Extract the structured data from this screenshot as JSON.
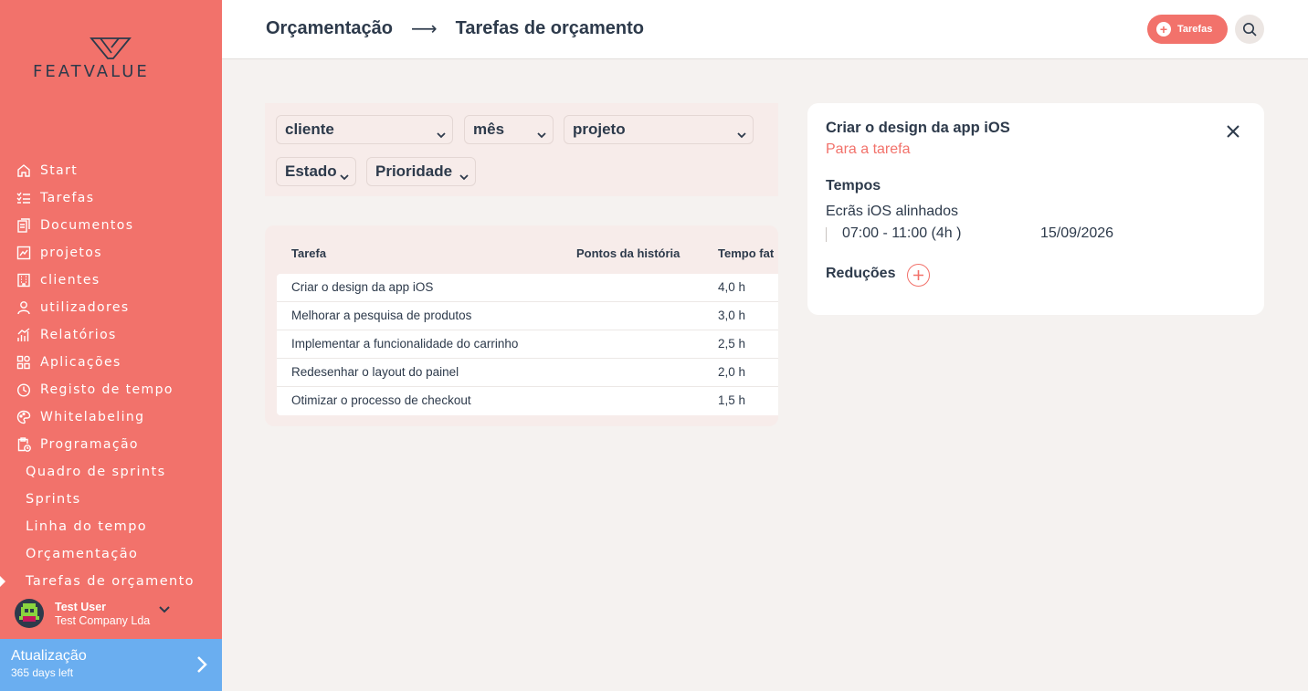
{
  "brand": {
    "logo_text": "FEATVALUE"
  },
  "sidebar": {
    "items": [
      {
        "label": "Start",
        "icon": "home-icon"
      },
      {
        "label": "Tarefas",
        "icon": "checklist-icon"
      },
      {
        "label": "Documentos",
        "icon": "documents-icon"
      },
      {
        "label": "projetos",
        "icon": "chart-icon"
      },
      {
        "label": "clientes",
        "icon": "building-icon"
      },
      {
        "label": "utilizadores",
        "icon": "user-icon"
      },
      {
        "label": "Relatórios",
        "icon": "bars-icon"
      },
      {
        "label": "Aplicações",
        "icon": "apps-icon"
      },
      {
        "label": "Registo de tempo",
        "icon": "timer-icon"
      },
      {
        "label": "Whitelabeling",
        "icon": "palette-icon"
      },
      {
        "label": "Programação",
        "icon": "clipboard-clock-icon"
      }
    ],
    "subitems": [
      {
        "label": "Quadro de sprints"
      },
      {
        "label": "Sprints"
      },
      {
        "label": "Linha do tempo"
      },
      {
        "label": "Orçamentação"
      },
      {
        "label": "Tarefas de orçamento",
        "active": true
      }
    ],
    "user": {
      "name": "Test User",
      "company": "Test Company Lda"
    },
    "upgrade": {
      "title": "Atualização",
      "subtitle": "365 days left"
    }
  },
  "header": {
    "breadcrumb": [
      "Orçamentação",
      "Tarefas de orçamento"
    ],
    "tasks_button": "Tarefas"
  },
  "filters": {
    "cliente": "cliente",
    "mes": "mês",
    "projeto": "projeto",
    "estado": "Estado",
    "prioridade": "Prioridade"
  },
  "table": {
    "columns": [
      "Tarefa",
      "Pontos da história",
      "Tempo fat"
    ],
    "rows": [
      {
        "tarefa": "Criar o design da app iOS",
        "pontos": "",
        "tempo": "4,0 h"
      },
      {
        "tarefa": "Melhorar a pesquisa de produtos",
        "pontos": "",
        "tempo": "3,0 h"
      },
      {
        "tarefa": "Implementar a funcionalidade do carrinho",
        "pontos": "",
        "tempo": "2,5 h"
      },
      {
        "tarefa": "Redesenhar o layout do painel",
        "pontos": "",
        "tempo": "2,0 h"
      },
      {
        "tarefa": "Otimizar o processo de checkout",
        "pontos": "",
        "tempo": "1,5 h"
      }
    ]
  },
  "detail": {
    "title": "Criar o design da app iOS",
    "link": "Para a tarefa",
    "times_heading": "Tempos",
    "entry_label": "Ecrãs iOS alinhados",
    "entry_time": "07:00 - 11:00 (4h )",
    "entry_date": "15/09/2026",
    "reductions_heading": "Reduções"
  },
  "colors": {
    "accent": "#f2726b",
    "sidebar": "#f2726b",
    "upgrade": "#6aaef0",
    "text": "#2d3a4b"
  }
}
